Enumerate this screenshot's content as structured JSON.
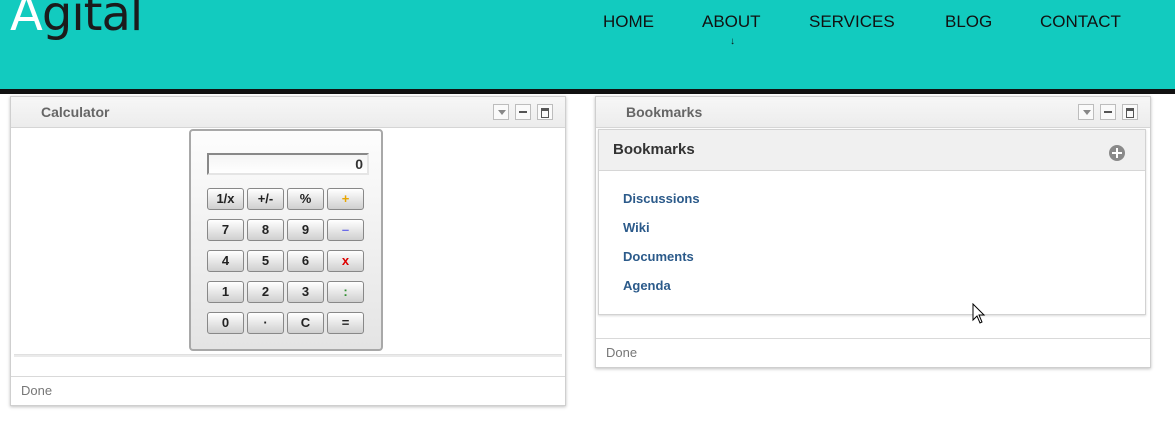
{
  "header": {
    "logo_first": "A",
    "logo_rest": "gital",
    "nav": [
      "HOME",
      "ABOUT",
      "SERVICES",
      "BLOG",
      "CONTACT"
    ],
    "about_arrow": "↓",
    "bg_color": "#12cbbf"
  },
  "calculator_portlet": {
    "title": "Calculator",
    "display": "0",
    "keys": [
      "1/x",
      "+/-",
      "%",
      "+",
      "7",
      "8",
      "9",
      "–",
      "4",
      "5",
      "6",
      "x",
      "1",
      "2",
      "3",
      ":",
      "0",
      "·",
      "C",
      "="
    ],
    "status": "Done"
  },
  "bookmarks_portlet": {
    "title": "Bookmarks",
    "box_title": "Bookmarks",
    "links": [
      "Discussions",
      "Wiki",
      "Documents",
      "Agenda"
    ],
    "status": "Done"
  }
}
